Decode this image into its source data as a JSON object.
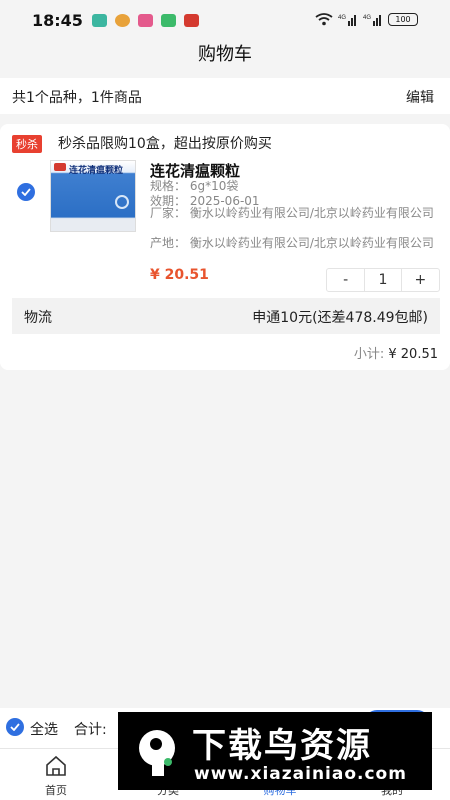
{
  "status_bar": {
    "time": "18:45",
    "battery": "100",
    "signal_1": "4G",
    "signal_2": "4G"
  },
  "nav": {
    "title": "购物车"
  },
  "summary": {
    "text": "共1个品种，1件商品",
    "edit_label": "编辑"
  },
  "promo": {
    "tag": "秒杀",
    "text": "秒杀品限购10盒，超出按原价购买"
  },
  "product": {
    "image_title": "连花清瘟颗粒",
    "name": "连花清瘟颗粒",
    "spec": "规格： 6g*10袋",
    "expiry": "效期： 2025-06-01",
    "manufacturer": "厂家： 衡水以岭药业有限公司/北京以岭药业有限公司",
    "origin": "产地： 衡水以岭药业有限公司/北京以岭药业有限公司",
    "price": "¥ 20.51",
    "quantity": "1",
    "minus": "-",
    "plus": "+"
  },
  "logistics": {
    "label": "物流",
    "value": "申通10元(还差478.49包邮)"
  },
  "subtotal": {
    "label": "小计:",
    "value": "¥ 20.51"
  },
  "checkout": {
    "select_all": "全选",
    "total_label": "合计:"
  },
  "tabs": [
    {
      "label": "首页"
    },
    {
      "label": "分类"
    },
    {
      "label": "购物车"
    },
    {
      "label": "我的"
    }
  ],
  "watermark": {
    "text": "下载鸟资源",
    "url": "www.xiazainiao.com"
  },
  "colors": {
    "accent": "#2f6fe0",
    "price": "#e8542e",
    "promo_tag": "#e84030"
  }
}
